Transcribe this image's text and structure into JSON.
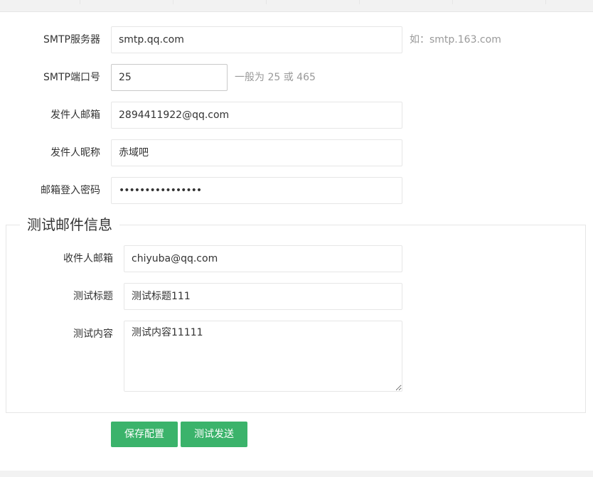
{
  "smtp_server": {
    "label": "SMTP服务器",
    "value": "smtp.qq.com",
    "hint": "如：smtp.163.com"
  },
  "smtp_port": {
    "label": "SMTP端口号",
    "value": "25",
    "hint": "一般为 25 或 465"
  },
  "sender_email": {
    "label": "发件人邮箱",
    "value": "2894411922@qq.com"
  },
  "sender_nickname": {
    "label": "发件人昵称",
    "value": "赤域吧"
  },
  "email_password": {
    "label": "邮箱登入密码",
    "value": "••••••••••••••••"
  },
  "test_section": {
    "legend": "测试邮件信息",
    "recipient": {
      "label": "收件人邮箱",
      "value": "chiyuba@qq.com"
    },
    "subject": {
      "label": "测试标题",
      "value": "测试标题111"
    },
    "content": {
      "label": "测试内容",
      "value": "测试内容11111"
    }
  },
  "buttons": {
    "save": "保存配置",
    "send_test": "测试发送"
  },
  "colors": {
    "button_bg": "#3bb36b",
    "border": "#e6e6e6",
    "hint": "#999999"
  }
}
